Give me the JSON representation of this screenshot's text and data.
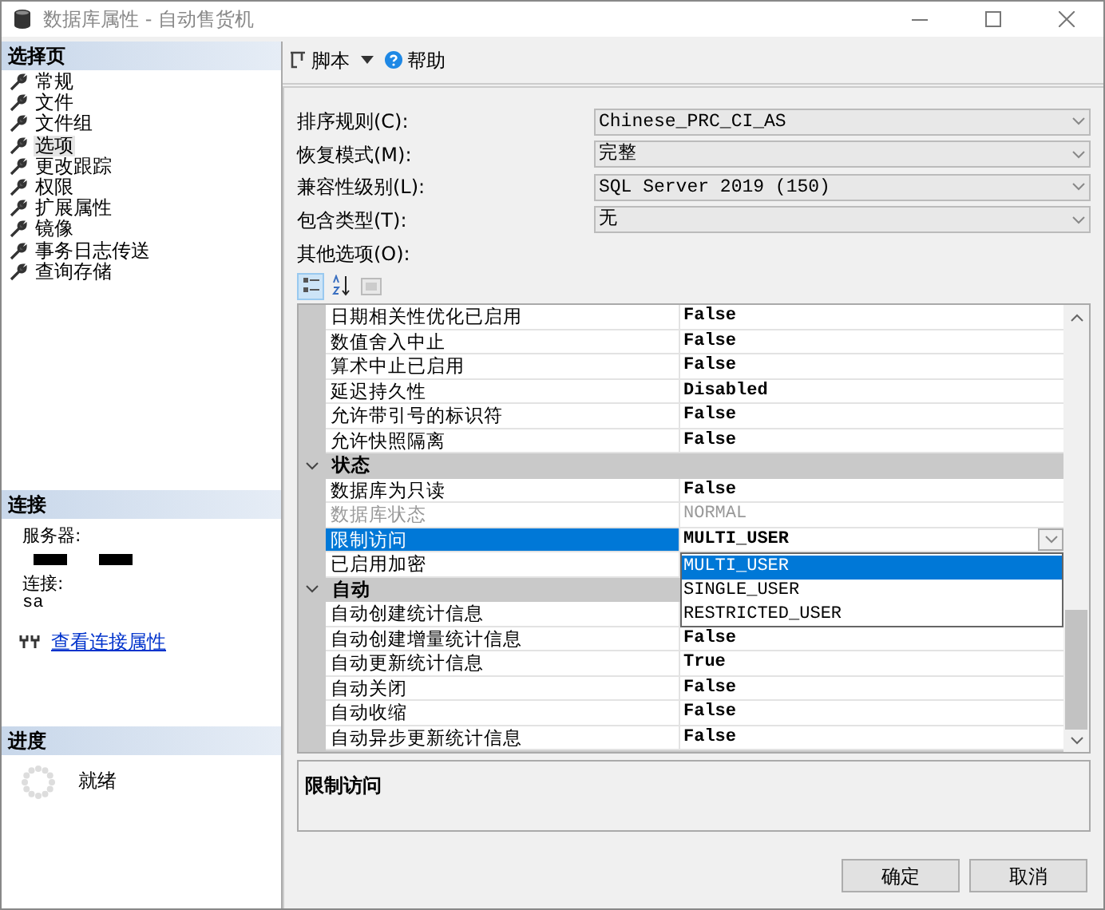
{
  "window": {
    "title": "数据库属性 - 自动售货机"
  },
  "select_page": {
    "header": "选择页",
    "items": [
      {
        "label": "常规",
        "selected": false
      },
      {
        "label": "文件",
        "selected": false
      },
      {
        "label": "文件组",
        "selected": false
      },
      {
        "label": "选项",
        "selected": true
      },
      {
        "label": "更改跟踪",
        "selected": false
      },
      {
        "label": "权限",
        "selected": false
      },
      {
        "label": "扩展属性",
        "selected": false
      },
      {
        "label": "镜像",
        "selected": false
      },
      {
        "label": "事务日志传送",
        "selected": false
      },
      {
        "label": "查询存储",
        "selected": false
      }
    ]
  },
  "connection": {
    "header": "连接",
    "server_label": "服务器:",
    "connection_label": "连接:",
    "connection_value": "sa",
    "link": "查看连接属性"
  },
  "progress": {
    "header": "进度",
    "status": "就绪"
  },
  "toolbar": {
    "script": "脚本",
    "help": "帮助"
  },
  "fields": [
    {
      "label": "排序规则(C):",
      "value": "Chinese_PRC_CI_AS"
    },
    {
      "label": "恢复模式(M):",
      "value": "完整"
    },
    {
      "label": "兼容性级别(L):",
      "value": "SQL Server 2019 (150)"
    },
    {
      "label": "包含类型(T):",
      "value": "无"
    }
  ],
  "other_options_label": "其他选项(O):",
  "grid_toolbar": [
    {
      "kind": "categorized",
      "selected": true
    },
    {
      "kind": "alphabetical",
      "selected": false
    },
    {
      "kind": "pages",
      "selected": false
    }
  ],
  "leading_rows": [
    {
      "name": "日期相关性优化已启用",
      "value": "False",
      "disabled": false,
      "selected": false
    },
    {
      "name": "数值舍入中止",
      "value": "False",
      "disabled": false,
      "selected": false
    },
    {
      "name": "算术中止已启用",
      "value": "False",
      "disabled": false,
      "selected": false
    },
    {
      "name": "延迟持久性",
      "value": "Disabled",
      "disabled": false,
      "selected": false
    },
    {
      "name": "允许带引号的标识符",
      "value": "False",
      "disabled": false,
      "selected": false
    },
    {
      "name": "允许快照隔离",
      "value": "False",
      "disabled": false,
      "selected": false
    }
  ],
  "categories": [
    {
      "name": "状态",
      "expanded": true,
      "rows": [
        {
          "name": "数据库为只读",
          "value": "False",
          "disabled": false,
          "selected": false
        },
        {
          "name": "数据库状态",
          "value": "NORMAL",
          "disabled": true,
          "selected": false
        },
        {
          "name": "限制访问",
          "value": "MULTI_USER",
          "disabled": false,
          "selected": true,
          "dropdown": {
            "options": [
              {
                "label": "MULTI_USER",
                "selected": true
              },
              {
                "label": "SINGLE_USER",
                "selected": false
              },
              {
                "label": "RESTRICTED_USER",
                "selected": false
              }
            ]
          }
        },
        {
          "name": "已启用加密",
          "disabled": false,
          "selected": false
        }
      ]
    },
    {
      "name": "自动",
      "expanded": true,
      "rows": [
        {
          "name": "自动创建统计信息",
          "disabled": false,
          "selected": false
        },
        {
          "name": "自动创建增量统计信息",
          "value": "False",
          "disabled": false,
          "selected": false
        },
        {
          "name": "自动更新统计信息",
          "value": "True",
          "disabled": false,
          "selected": false
        },
        {
          "name": "自动关闭",
          "value": "False",
          "disabled": false,
          "selected": false
        },
        {
          "name": "自动收缩",
          "value": "False",
          "disabled": false,
          "selected": false
        },
        {
          "name": "自动异步更新统计信息",
          "value": "False",
          "disabled": false,
          "selected": false
        }
      ]
    }
  ],
  "description": {
    "title": "限制访问"
  },
  "buttons": [
    "确定",
    "取消"
  ]
}
